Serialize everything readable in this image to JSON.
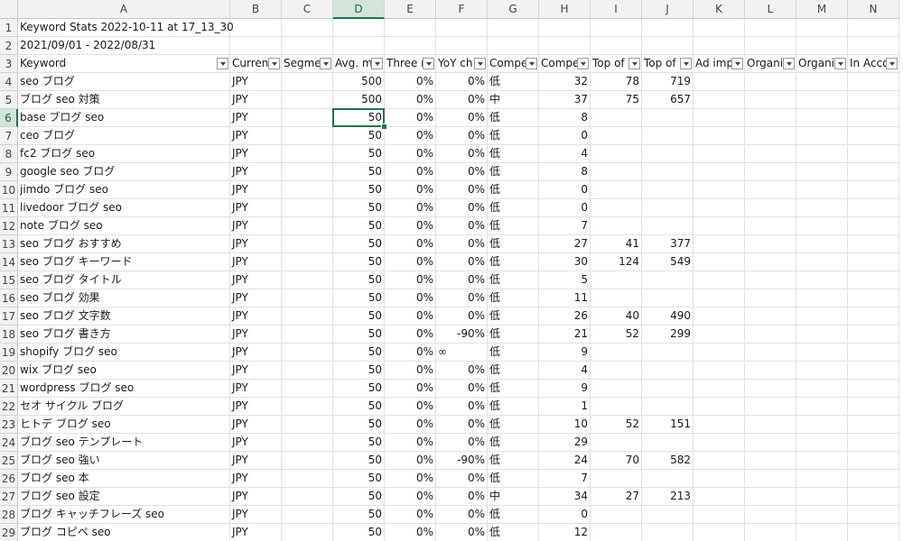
{
  "columns": [
    "A",
    "B",
    "C",
    "D",
    "E",
    "F",
    "G",
    "H",
    "I",
    "J",
    "K",
    "L",
    "M",
    "N"
  ],
  "selected_cell": "D6",
  "title_rows": [
    "Keyword Stats 2022-10-11 at 17_13_30",
    "2021/09/01 - 2022/08/31"
  ],
  "headers": [
    "Keyword",
    "Currenc",
    "Segmen",
    "Avg. mo",
    "Three m",
    "YoY ch",
    "Compet",
    "Compet",
    "Top of p",
    "Top of p",
    "Ad impr",
    "Organic",
    "Organic",
    "In Acco"
  ],
  "rows": [
    [
      "seo ブログ",
      "JPY",
      "",
      "500",
      "0%",
      "0%",
      "低",
      "32",
      "78",
      "719"
    ],
    [
      "ブログ seo 対策",
      "JPY",
      "",
      "500",
      "0%",
      "0%",
      "中",
      "37",
      "75",
      "657"
    ],
    [
      "base ブログ seo",
      "JPY",
      "",
      "50",
      "0%",
      "0%",
      "低",
      "8",
      "",
      ""
    ],
    [
      "ceo ブログ",
      "JPY",
      "",
      "50",
      "0%",
      "0%",
      "低",
      "0",
      "",
      ""
    ],
    [
      "fc2 ブログ seo",
      "JPY",
      "",
      "50",
      "0%",
      "0%",
      "低",
      "4",
      "",
      ""
    ],
    [
      "google seo ブログ",
      "JPY",
      "",
      "50",
      "0%",
      "0%",
      "低",
      "8",
      "",
      ""
    ],
    [
      "jimdo ブログ seo",
      "JPY",
      "",
      "50",
      "0%",
      "0%",
      "低",
      "0",
      "",
      ""
    ],
    [
      "livedoor ブログ seo",
      "JPY",
      "",
      "50",
      "0%",
      "0%",
      "低",
      "0",
      "",
      ""
    ],
    [
      "note ブログ seo",
      "JPY",
      "",
      "50",
      "0%",
      "0%",
      "低",
      "7",
      "",
      ""
    ],
    [
      "seo ブログ おすすめ",
      "JPY",
      "",
      "50",
      "0%",
      "0%",
      "低",
      "27",
      "41",
      "377"
    ],
    [
      "seo ブログ キーワード",
      "JPY",
      "",
      "50",
      "0%",
      "0%",
      "低",
      "30",
      "124",
      "549"
    ],
    [
      "seo ブログ タイトル",
      "JPY",
      "",
      "50",
      "0%",
      "0%",
      "低",
      "5",
      "",
      ""
    ],
    [
      "seo ブログ 効果",
      "JPY",
      "",
      "50",
      "0%",
      "0%",
      "低",
      "11",
      "",
      ""
    ],
    [
      "seo ブログ 文字数",
      "JPY",
      "",
      "50",
      "0%",
      "0%",
      "低",
      "26",
      "40",
      "490"
    ],
    [
      "seo ブログ 書き方",
      "JPY",
      "",
      "50",
      "0%",
      "-90%",
      "低",
      "21",
      "52",
      "299"
    ],
    [
      "shopify ブログ seo",
      "JPY",
      "",
      "50",
      "0%",
      "∞",
      "低",
      "9",
      "",
      ""
    ],
    [
      "wix ブログ seo",
      "JPY",
      "",
      "50",
      "0%",
      "0%",
      "低",
      "4",
      "",
      ""
    ],
    [
      "wordpress ブログ seo",
      "JPY",
      "",
      "50",
      "0%",
      "0%",
      "低",
      "9",
      "",
      ""
    ],
    [
      "セオ サイクル ブログ",
      "JPY",
      "",
      "50",
      "0%",
      "0%",
      "低",
      "1",
      "",
      ""
    ],
    [
      "ヒトデ ブログ seo",
      "JPY",
      "",
      "50",
      "0%",
      "0%",
      "低",
      "10",
      "52",
      "151"
    ],
    [
      "ブログ seo テンプレート",
      "JPY",
      "",
      "50",
      "0%",
      "0%",
      "低",
      "29",
      "",
      ""
    ],
    [
      "ブログ seo 強い",
      "JPY",
      "",
      "50",
      "0%",
      "-90%",
      "低",
      "24",
      "70",
      "582"
    ],
    [
      "ブログ seo 本",
      "JPY",
      "",
      "50",
      "0%",
      "0%",
      "低",
      "7",
      "",
      ""
    ],
    [
      "ブログ seo 設定",
      "JPY",
      "",
      "50",
      "0%",
      "0%",
      "中",
      "34",
      "27",
      "213"
    ],
    [
      "ブログ キャッチフレーズ seo",
      "JPY",
      "",
      "50",
      "0%",
      "0%",
      "低",
      "0",
      "",
      ""
    ],
    [
      "ブログ コピペ seo",
      "JPY",
      "",
      "50",
      "0%",
      "0%",
      "低",
      "12",
      "",
      ""
    ]
  ]
}
